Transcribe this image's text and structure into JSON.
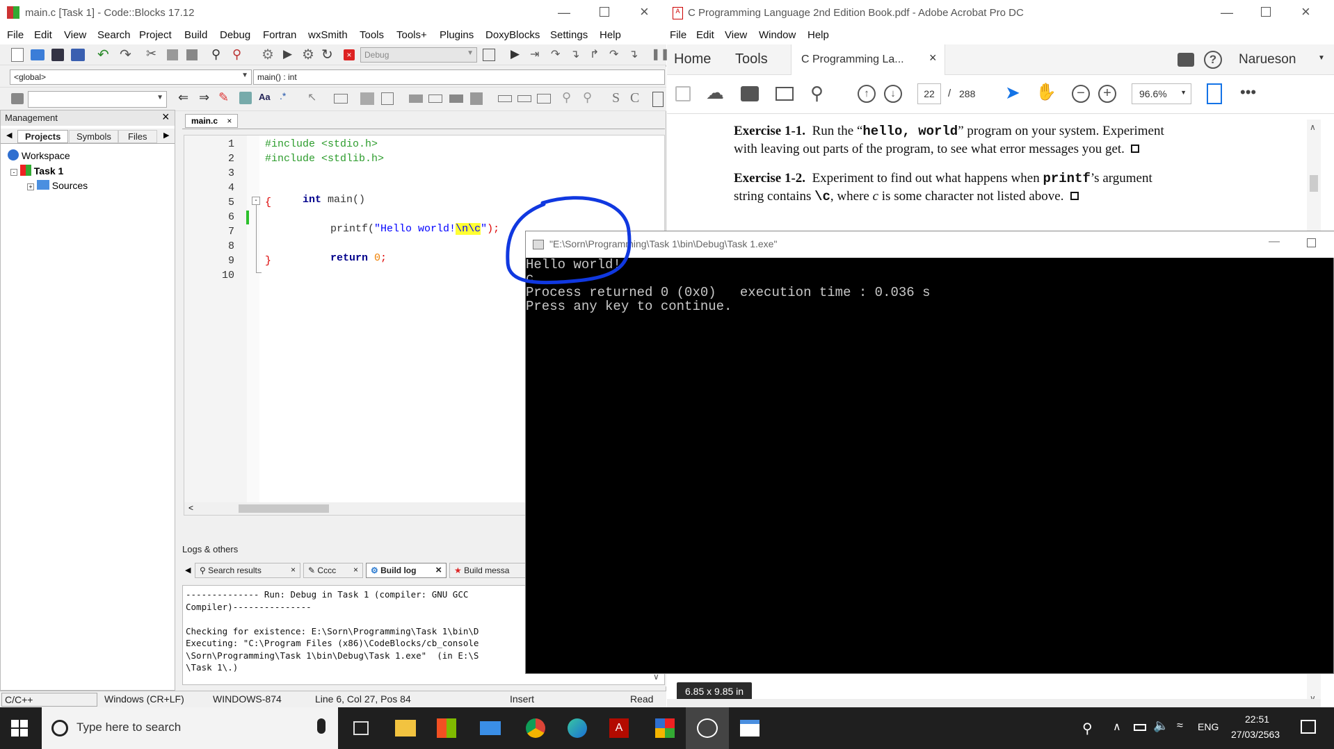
{
  "codeblocks": {
    "title": "main.c [Task 1] - Code::Blocks 17.12",
    "menu": [
      "File",
      "Edit",
      "View",
      "Search",
      "Project",
      "Build",
      "Debug",
      "Fortran",
      "wxSmith",
      "Tools",
      "Tools+",
      "Plugins",
      "DoxyBlocks",
      "Settings",
      "Help"
    ],
    "build_target": "Debug",
    "scope": "<global>",
    "function": "main() : int",
    "management": {
      "title": "Management",
      "tabs": [
        "Projects",
        "Symbols",
        "Files"
      ],
      "tree": {
        "workspace": "Workspace",
        "project": "Task 1",
        "folder": "Sources"
      }
    },
    "editor": {
      "tab": "main.c",
      "line_numbers": [
        "1",
        "2",
        "3",
        "4",
        "5",
        "6",
        "7",
        "8",
        "9",
        "10"
      ],
      "code": {
        "l1": "#include <stdio.h>",
        "l2": "#include <stdlib.h>",
        "l4_kw": "int",
        "l4_rest": " main()",
        "l5": "{",
        "l6_a": "printf(",
        "l6_b": "\"Hello world!",
        "l6_c": "\\n\\c",
        "l6_d": "\"",
        "l6_e": ");",
        "l8_kw": "return",
        "l8_num": " 0",
        "l8_end": ";",
        "l9": "}"
      }
    },
    "logs": {
      "title": "Logs & others",
      "tabs": [
        "Search results",
        "Cccc",
        "Build log",
        "Build messa"
      ],
      "text": "-------------- Run: Debug in Task 1 (compiler: GNU GCC\nCompiler)---------------\n\nChecking for existence: E:\\Sorn\\Programming\\Task 1\\bin\\D\nExecuting: \"C:\\Program Files (x86)\\CodeBlocks/cb_console\n\\Sorn\\Programming\\Task 1\\bin\\Debug\\Task 1.exe\"  (in E:\\S\n\\Task 1\\.)"
    },
    "status": {
      "lang": "C/C++",
      "eol": "Windows (CR+LF)",
      "encoding": "WINDOWS-874",
      "pos": "Line 6, Col 27, Pos 84",
      "mode": "Insert",
      "rw": "Read"
    }
  },
  "acrobat": {
    "title": "C Programming Language 2nd Edition Book.pdf - Adobe Acrobat Pro DC",
    "menu": [
      "File",
      "Edit",
      "View",
      "Window",
      "Help"
    ],
    "nav": {
      "home": "Home",
      "tools": "Tools",
      "doc_tab": "C Programming La...",
      "user": "Narueson"
    },
    "page_current": "22",
    "page_sep": "/",
    "page_total": "288",
    "zoom": "96.6%",
    "exercise1_label": "Exercise 1-1.",
    "exercise1_text_a": "Run the “",
    "exercise1_code": "hello, world",
    "exercise1_text_b": "” program on your system.  Experiment",
    "exercise1_line2": "with leaving out parts of the program, to see what error messages you get.",
    "exercise2_label": "Exercise 1-2.",
    "exercise2_text_a": "Experiment to find out what happens when ",
    "exercise2_code": "printf",
    "exercise2_text_b": "’s argument",
    "exercise2_line2_a": "string contains ",
    "exercise2_line2_code": "\\c",
    "exercise2_line2_b": ", where ",
    "exercise2_line2_c": "c",
    "exercise2_line2_d": " is some character not listed above.",
    "page_size": "6.85 x 9.85 in"
  },
  "console": {
    "title": "\"E:\\Sorn\\Programming\\Task 1\\bin\\Debug\\Task 1.exe\"",
    "lines": [
      "Hello world!",
      "c",
      "Process returned 0 (0x0)   execution time : 0.036 s",
      "Press any key to continue."
    ]
  },
  "taskbar": {
    "search_placeholder": "Type here to search",
    "lang": "ENG",
    "time": "22:51",
    "date": "27/03/2563"
  },
  "colors": {
    "annotation": "#1038e0",
    "highlight": "#ffff33",
    "preproc": "#2c9c2c",
    "keyword": "#00008b",
    "string": "#0000ff"
  }
}
